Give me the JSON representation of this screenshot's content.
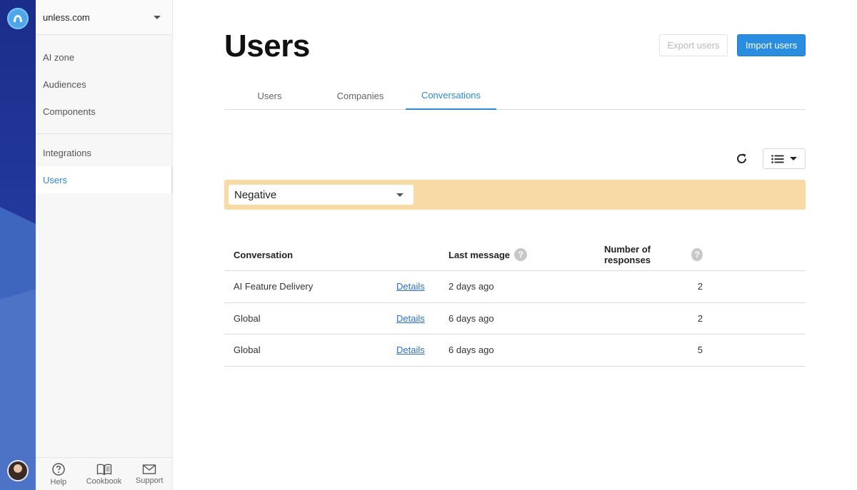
{
  "workspace": {
    "name": "unless.com"
  },
  "sidebar": {
    "groups": [
      {
        "items": [
          {
            "label": "AI zone"
          },
          {
            "label": "Audiences"
          },
          {
            "label": "Components"
          }
        ]
      },
      {
        "items": [
          {
            "label": "Integrations"
          },
          {
            "label": "Users",
            "active": true
          }
        ]
      }
    ],
    "footer": [
      {
        "label": "Help",
        "icon": "help-circle-icon"
      },
      {
        "label": "Cookbook",
        "icon": "book-icon"
      },
      {
        "label": "Support",
        "icon": "mail-icon"
      }
    ]
  },
  "page": {
    "title": "Users",
    "export_label": "Export users",
    "import_label": "Import users"
  },
  "tabs": [
    {
      "label": "Users"
    },
    {
      "label": "Companies"
    },
    {
      "label": "Conversations",
      "active": true
    }
  ],
  "toolbar": {
    "refresh_icon": "refresh-icon",
    "view_icon": "list-icon"
  },
  "filter": {
    "selected": "Negative"
  },
  "table": {
    "headers": {
      "conversation": "Conversation",
      "last_message": "Last message",
      "responses": "Number of responses"
    },
    "rows": [
      {
        "conversation": "AI Feature Delivery",
        "link": "Details",
        "last_message": "2 days ago",
        "responses": "2"
      },
      {
        "conversation": "Global",
        "link": "Details",
        "last_message": "6 days ago",
        "responses": "2"
      },
      {
        "conversation": "Global",
        "link": "Details",
        "last_message": "6 days ago",
        "responses": "5"
      }
    ]
  },
  "colors": {
    "accent": "#2a8ad4",
    "primary_button": "#2b8de0",
    "filter_bar": "#f8dba4",
    "rail": "#1a2d8a"
  }
}
